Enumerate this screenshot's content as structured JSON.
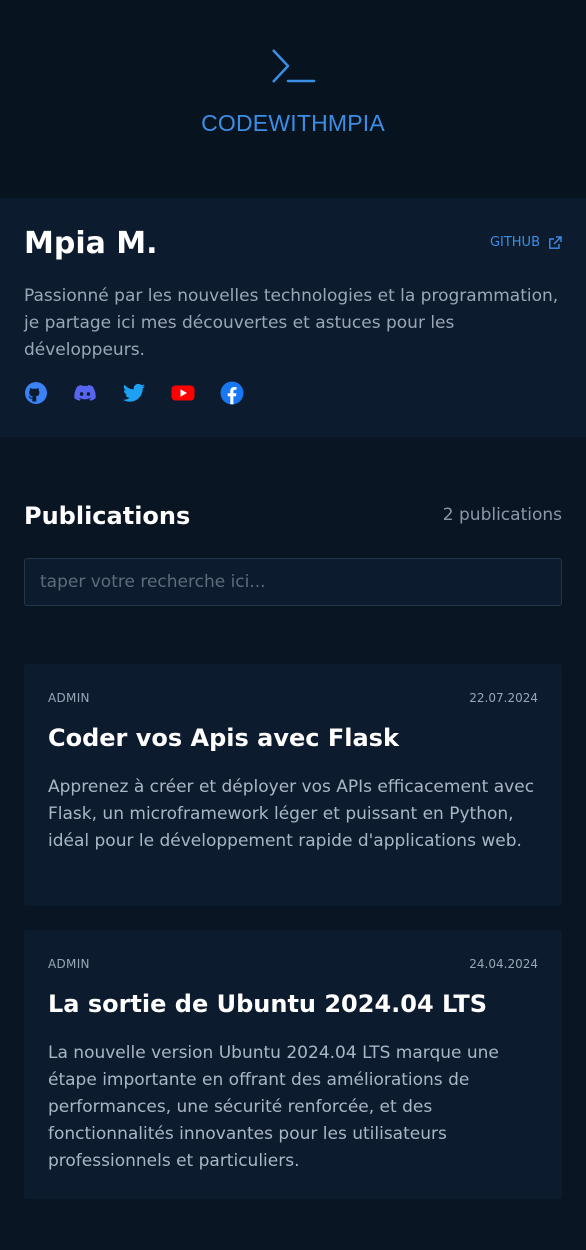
{
  "header": {
    "logo_icon": "terminal-prompt-icon",
    "brand": "CODEWITHMPIA"
  },
  "profile": {
    "name": "Mpia M.",
    "github_label": "GITHUB",
    "github_icon": "external-link-icon",
    "bio": "Passionné par les nouvelles technologies et la programmation, je partage ici mes découvertes et astuces pour les développeurs.",
    "socials": [
      {
        "name": "github-icon",
        "color": "#3b82f6"
      },
      {
        "name": "discord-icon",
        "color": "#5865f2"
      },
      {
        "name": "twitter-icon",
        "color": "#1da1f2"
      },
      {
        "name": "youtube-icon",
        "color": "#ff0000"
      },
      {
        "name": "facebook-icon",
        "color": "#1877f2"
      }
    ]
  },
  "publications": {
    "title": "Publications",
    "count": "2 publications",
    "search_placeholder": "taper votre recherche ici..."
  },
  "posts": [
    {
      "author": "ADMIN",
      "date": "22.07.2024",
      "title": "Coder vos Apis avec Flask",
      "excerpt": "Apprenez à créer et déployer vos APIs efficacement avec Flask, un microframework léger et puissant en Python, idéal pour le développement rapide d'applications web."
    },
    {
      "author": "ADMIN",
      "date": "24.04.2024",
      "title": "La sortie de Ubuntu 2024.04 LTS",
      "excerpt": "La nouvelle version Ubuntu 2024.04 LTS marque une étape importante en offrant des améliorations de performances, une sécurité renforcée, et des fonctionnalités innovantes pour les utilisateurs professionnels et particuliers."
    }
  ],
  "colors": {
    "accent": "#3b8ee6",
    "background": "#0a1524",
    "card": "#0d1b2e"
  }
}
